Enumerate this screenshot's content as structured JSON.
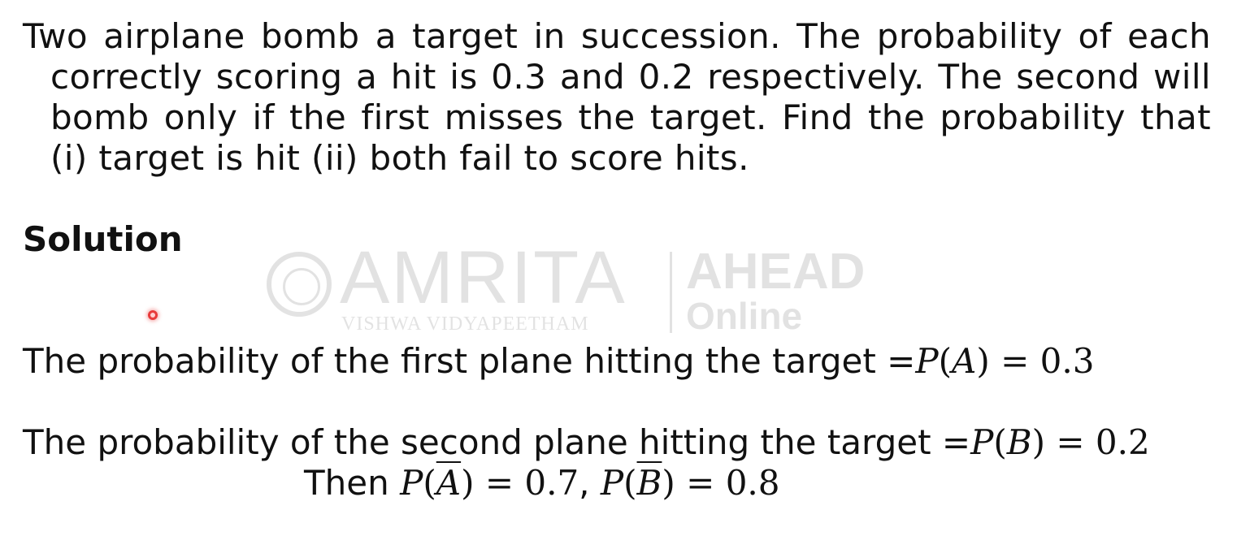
{
  "problem": {
    "line1": "Two airplane bomb a target in succession. The probability of each",
    "line2": "correctly scoring a hit is 0.3 and 0.2 respectively. The second will",
    "line3": "bomb only if the first misses the target. Find the probability that",
    "line4": "(i) target is hit  (ii) both fail to score hits."
  },
  "solution": {
    "heading": "Solution",
    "s1_text": "The probability of the first plane hitting the target =",
    "s1_math": "= 0.3",
    "s2_text": "The probability of the second plane hitting the target =",
    "s2_math": "= 0.2",
    "s3_then": "Then ",
    "s3_a_val": " = 0.7",
    "s3_sep": ", ",
    "s3_b_val": " = 0.8"
  },
  "watermark": {
    "brand": "AMRITA",
    "subtitle": "VISHWA VIDYAPEETHAM",
    "ahead": "AHEAD",
    "online": "Online"
  },
  "colors": {
    "text": "#111111",
    "background": "#ffffff",
    "pointer": "#e83a3a"
  }
}
